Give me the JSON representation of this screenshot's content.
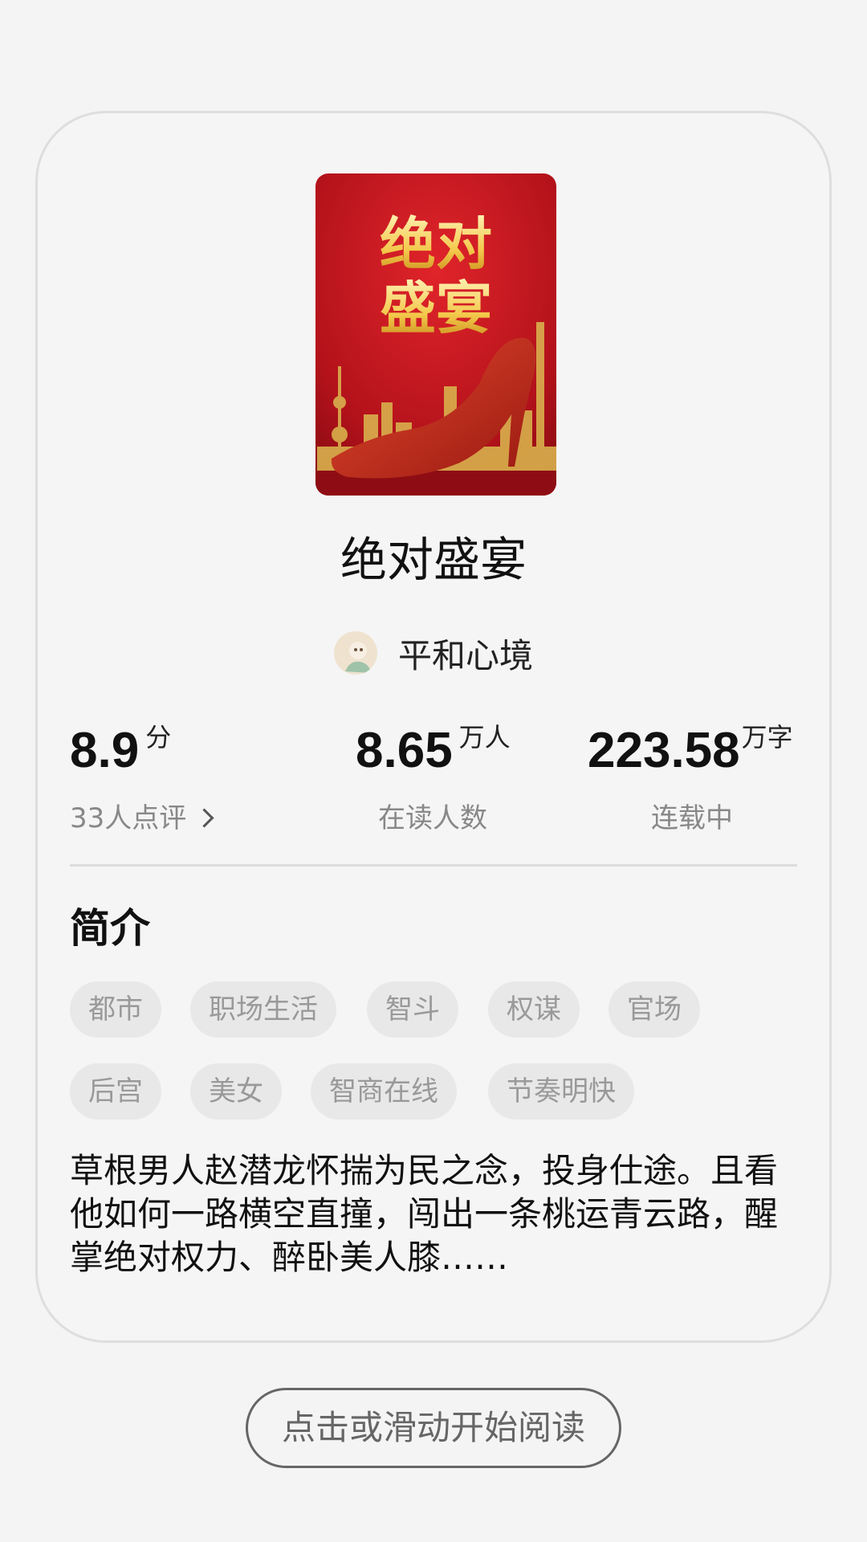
{
  "book": {
    "cover_title": "绝对盛宴",
    "title": "绝对盛宴",
    "author": "平和心境"
  },
  "stats": {
    "rating": {
      "value": "8.9",
      "unit": "分",
      "label": "33人点评"
    },
    "readers": {
      "value": "8.65",
      "unit": "万人",
      "label": "在读人数"
    },
    "words": {
      "value": "223.58",
      "unit": "万字",
      "label": "连载中"
    }
  },
  "intro": {
    "heading": "简介",
    "tags": [
      "都市",
      "职场生活",
      "智斗",
      "权谋",
      "官场",
      "后宫",
      "美女",
      "智商在线",
      "节奏明快"
    ],
    "description": "草根男人赵潜龙怀揣为民之念，投身仕途。且看他如何一路横空直撞，闯出一条桃运青云路，醒掌绝对权力、醉卧美人膝……"
  },
  "actions": {
    "start_reading": "点击或滑动开始阅读"
  },
  "colors": {
    "cover_red": "#b3121b",
    "cover_gold": "#f3c84a"
  }
}
